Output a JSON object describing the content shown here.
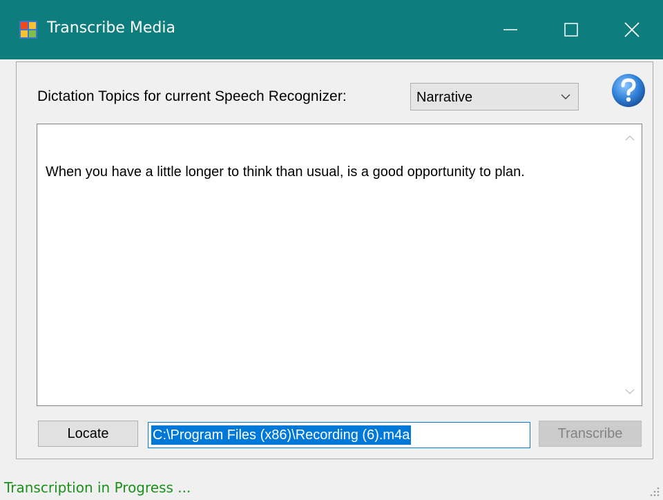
{
  "window": {
    "title": "Transcribe Media",
    "titlebar_color": "#0e7d7d",
    "icons": {
      "app": "app-window-icon",
      "minimize": "minimize-icon",
      "maximize": "maximize-icon",
      "close": "close-icon"
    }
  },
  "topics": {
    "label": "Dictation Topics for current Speech Recognizer:",
    "selected": "Narrative",
    "dropdown_icon": "chevron-down-icon"
  },
  "help": {
    "icon": "help-icon",
    "color": "#2f7fd6"
  },
  "transcript": {
    "text": "When you have a little longer to think than usual, is a good opportunity to plan."
  },
  "controls": {
    "locate_label": "Locate",
    "path_value": "C:\\Program Files (x86)\\Recording (6).m4a",
    "transcribe_label": "Transcribe"
  },
  "status": {
    "text": "Transcription in Progress ...",
    "color": "#1a8f1a"
  }
}
